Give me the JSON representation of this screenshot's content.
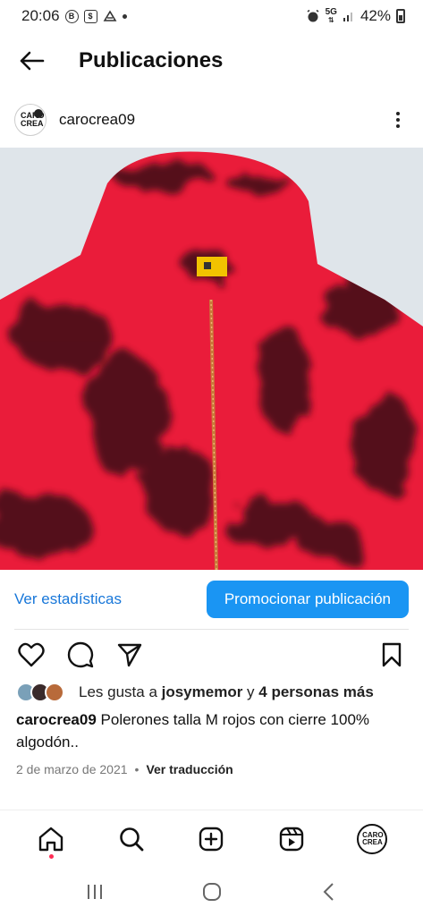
{
  "status_bar": {
    "time": "20:06",
    "battery": "42%",
    "network": "5G",
    "left_icons": [
      "b-icon",
      "shop-icon",
      "notification-icon"
    ],
    "right_icons": [
      "alarm-icon",
      "5g-icon",
      "signal-icon",
      "battery-icon"
    ]
  },
  "header": {
    "title": "Publicaciones"
  },
  "post": {
    "username": "carocrea09",
    "avatar_text": "CARO CREA",
    "image_description_icon": "red-tie-dye-hoodie-image",
    "stats_link": "Ver estadísticas",
    "promote_button": "Promocionar publicación",
    "likes": {
      "prefix": "Les gusta a ",
      "user": "josymemor",
      "connector": " y ",
      "others": "4 personas más"
    },
    "caption": {
      "username": "carocrea09",
      "text": " Polerones talla M rojos con cierre 100% algodón.."
    },
    "date": "2 de marzo de 2021",
    "translate_link": "Ver traducción"
  },
  "colors": {
    "accent": "#1a95f3",
    "link": "#1877d9",
    "notification_dot": "#ff2d55",
    "hoodie_red": "#ea1c3a",
    "hoodie_dark": "#3a0a14"
  }
}
